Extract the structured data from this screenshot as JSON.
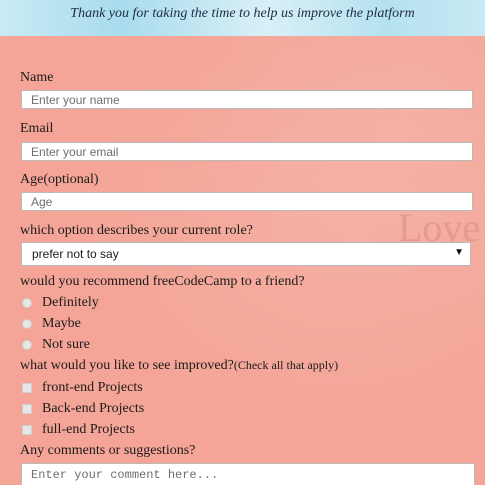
{
  "header": {
    "subtitle": "Thank you for taking the time to help us improve the platform"
  },
  "background": {
    "watermark_text": "Love"
  },
  "form": {
    "name": {
      "label": "Name",
      "placeholder": "Enter your name"
    },
    "email": {
      "label": "Email",
      "placeholder": "Enter your email"
    },
    "age": {
      "label": "Age(optional)",
      "placeholder": "Age"
    },
    "role": {
      "label": "which option describes your current role?",
      "selected": "prefer not to say"
    },
    "recommend": {
      "label": "would you recommend freeCodeCamp to a friend?",
      "options": [
        "Definitely",
        "Maybe",
        "Not sure"
      ]
    },
    "improve": {
      "label": "what would you like to see improved?",
      "note": "(Check all that apply)",
      "options": [
        "front-end Projects",
        "Back-end Projects",
        "full-end Projects"
      ]
    },
    "comments": {
      "label": "Any comments or suggestions?",
      "placeholder": "Enter your comment here..."
    }
  },
  "colors": {
    "panel": "#f4a597",
    "banner": "#bfe6f2"
  }
}
